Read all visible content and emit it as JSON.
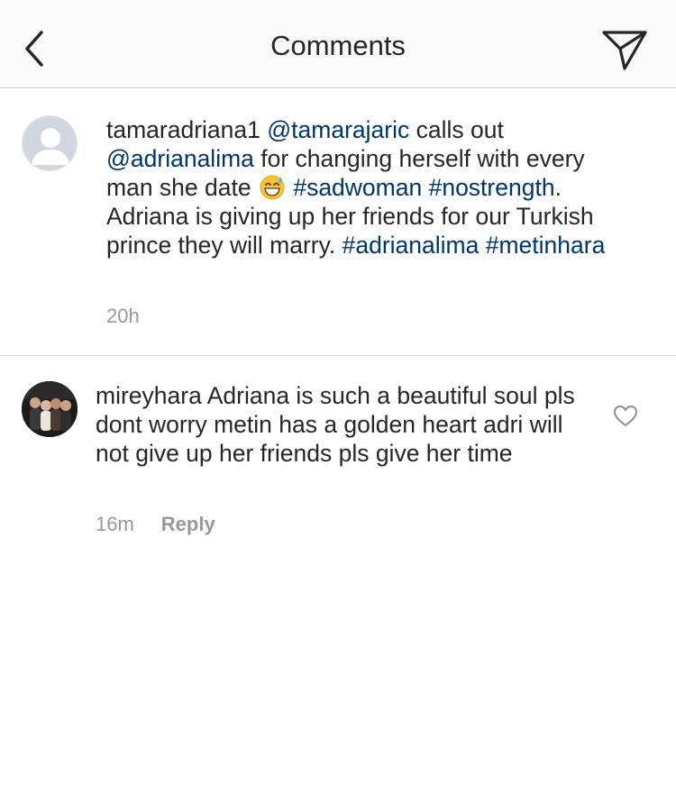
{
  "header": {
    "title": "Comments",
    "back_icon": "chevron-left-icon",
    "send_icon": "paper-plane-icon"
  },
  "post": {
    "username": "tamaradriana1",
    "mention_1": "@tamarajaric",
    "text_1": " calls out ",
    "mention_2": "@adrianalima",
    "text_2": " for changing herself with every man she date ",
    "emoji": "grinning-face-with-sweat",
    "hashtag_1": "#sadwoman",
    "hashtag_2": "#nostrength",
    "text_3": ". Adriana is giving up her friends for our Turkish prince they will marry. ",
    "hashtag_3": "#adrianalima",
    "hashtag_4": "#metinhara",
    "time": "20h"
  },
  "comment": {
    "username": "mireyhara",
    "text": "Adriana is such a beautiful soul pls dont worry metin has a golden heart adri will not give up her friends pls give her time",
    "time": "16m",
    "reply_label": "Reply",
    "like_icon": "heart-outline-icon"
  },
  "colors": {
    "link": "#003569",
    "meta": "#999999",
    "text": "#262626",
    "header_bg": "#f9f9f9"
  }
}
